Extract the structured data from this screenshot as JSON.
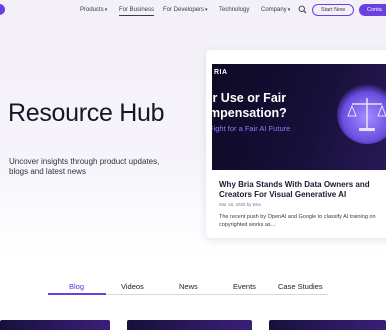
{
  "nav": {
    "items": [
      {
        "label": "Products",
        "has_menu": true
      },
      {
        "label": "For Business",
        "has_menu": false,
        "active": true
      },
      {
        "label": "For Developers",
        "has_menu": true
      },
      {
        "label": "Technology",
        "has_menu": false
      },
      {
        "label": "Company",
        "has_menu": true
      }
    ],
    "start_label": "Start Now",
    "contact_label": "Conta"
  },
  "hero": {
    "title": "Resource Hub",
    "subtitle": "Uncover insights through product updates, blogs and latest news"
  },
  "featured": {
    "image_logo": "RIA",
    "image_heading_line1": "ir Use or Fair",
    "image_heading_line2": "mpensation?",
    "image_tagline": "Fight for a Fair AI Future",
    "title": "Why Bria Stands With Data Owners and Creators For Visual Generative AI",
    "meta": "Mar 18, 2025 by Bria",
    "excerpt": "The recent push by OpenAI and Google to classify AI training on copyrighted works as..."
  },
  "tabs": [
    {
      "label": "Blog",
      "active": true
    },
    {
      "label": "Videos"
    },
    {
      "label": "News"
    },
    {
      "label": "Events"
    },
    {
      "label": "Case Studies"
    }
  ],
  "colors": {
    "accent": "#6b3fe0",
    "hero_bg": "#f3f1f7",
    "card_image": "#0d0a24"
  }
}
